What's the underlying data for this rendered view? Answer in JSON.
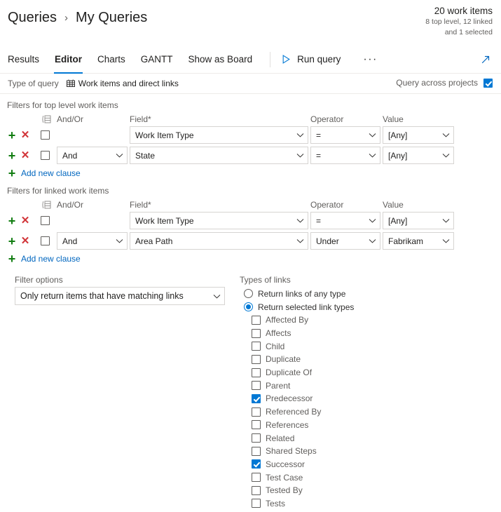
{
  "header": {
    "breadcrumb_root": "Queries",
    "breadcrumb_separator": "›",
    "breadcrumb_current": "My Queries",
    "count_main": "20 work items",
    "count_sub_line1": "8 top level, 12 linked",
    "count_sub_line2": "and 1 selected"
  },
  "tabs": [
    {
      "label": "Results",
      "active": false
    },
    {
      "label": "Editor",
      "active": true
    },
    {
      "label": "Charts",
      "active": false
    },
    {
      "label": "GANTT",
      "active": false
    },
    {
      "label": "Show as Board",
      "active": false
    }
  ],
  "toolbar": {
    "run_query_label": "Run query",
    "run_icon": "play-icon",
    "more_label": "···",
    "expand_icon": "expand-icon"
  },
  "query_type": {
    "label": "Type of query",
    "icon": "grid-icon",
    "value": "Work items and direct links",
    "across_projects_label": "Query across projects",
    "across_projects_checked": true
  },
  "top_level": {
    "section_title": "Filters for top level work items",
    "columns": {
      "list_icon": "list-icon",
      "andor": "And/Or",
      "field": "Field*",
      "operator": "Operator",
      "value": "Value"
    },
    "rows": [
      {
        "checked": false,
        "andor": "",
        "field": "Work Item Type",
        "operator": "=",
        "value": "[Any]"
      },
      {
        "checked": false,
        "andor": "And",
        "field": "State",
        "operator": "=",
        "value": "[Any]"
      }
    ],
    "add_clause": "Add new clause",
    "add_icon": "plus-icon",
    "remove_icon": "remove-icon"
  },
  "linked": {
    "section_title": "Filters for linked work items",
    "columns": {
      "list_icon": "list-icon",
      "andor": "And/Or",
      "field": "Field*",
      "operator": "Operator",
      "value": "Value"
    },
    "rows": [
      {
        "checked": false,
        "andor": "",
        "field": "Work Item Type",
        "operator": "=",
        "value": "[Any]"
      },
      {
        "checked": false,
        "andor": "And",
        "field": "Area Path",
        "operator": "Under",
        "value": "Fabrikam"
      }
    ],
    "add_clause": "Add new clause"
  },
  "filter_options": {
    "label": "Filter options",
    "value": "Only return items that have matching links"
  },
  "types_of_links": {
    "label": "Types of links",
    "radios": [
      {
        "label": "Return links of any type",
        "selected": false
      },
      {
        "label": "Return selected link types",
        "selected": true
      }
    ],
    "items": [
      {
        "label": "Affected By",
        "checked": false
      },
      {
        "label": "Affects",
        "checked": false
      },
      {
        "label": "Child",
        "checked": false
      },
      {
        "label": "Duplicate",
        "checked": false
      },
      {
        "label": "Duplicate Of",
        "checked": false
      },
      {
        "label": "Parent",
        "checked": false
      },
      {
        "label": "Predecessor",
        "checked": true
      },
      {
        "label": "Referenced By",
        "checked": false
      },
      {
        "label": "References",
        "checked": false
      },
      {
        "label": "Related",
        "checked": false
      },
      {
        "label": "Shared Steps",
        "checked": false
      },
      {
        "label": "Successor",
        "checked": true
      },
      {
        "label": "Test Case",
        "checked": false
      },
      {
        "label": "Tested By",
        "checked": false
      },
      {
        "label": "Tests",
        "checked": false
      }
    ]
  },
  "colors": {
    "accent": "#0078d4",
    "add": "#107c10",
    "remove": "#d13438",
    "link": "#0066bf",
    "muted": "#605e5c"
  }
}
